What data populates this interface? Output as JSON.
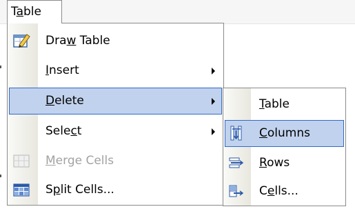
{
  "menu_title": {
    "prefix": "T",
    "underline": "a",
    "rest": "ble"
  },
  "main_menu": {
    "draw_table": {
      "prefix": "Dra",
      "underline": "w",
      "rest": " Table"
    },
    "insert": {
      "prefix": "",
      "underline": "I",
      "rest": "nsert"
    },
    "delete": {
      "prefix": "",
      "underline": "D",
      "rest": "elete"
    },
    "select": {
      "prefix": "Sele",
      "underline": "c",
      "rest": "t"
    },
    "merge_cells": {
      "prefix": "",
      "underline": "M",
      "rest": "erge Cells"
    },
    "split_cells": {
      "prefix": "S",
      "underline": "p",
      "rest": "lit Cells..."
    }
  },
  "sub_menu": {
    "table": {
      "prefix": "",
      "underline": "T",
      "rest": "able"
    },
    "columns": {
      "prefix": "",
      "underline": "C",
      "rest": "olumns"
    },
    "rows": {
      "prefix": "",
      "underline": "R",
      "rest": "ows"
    },
    "cells": {
      "prefix": "C",
      "underline": "e",
      "rest": "lls..."
    }
  },
  "state": {
    "open_menu": "Table",
    "highlighted_item": "Delete",
    "highlighted_subitem": "Columns",
    "disabled_items": [
      "Merge Cells"
    ]
  },
  "icons": {
    "draw_table": "pencil-table-icon",
    "merge_cells": "merge-cells-icon",
    "split_cells": "split-cells-icon",
    "delete_columns": "delete-columns-icon",
    "delete_rows": "delete-rows-icon",
    "delete_cells": "delete-cells-icon"
  },
  "colors": {
    "highlight_fill": "#c1d2ee",
    "highlight_border": "#316ac5",
    "disabled_text": "#a2a2a2"
  }
}
